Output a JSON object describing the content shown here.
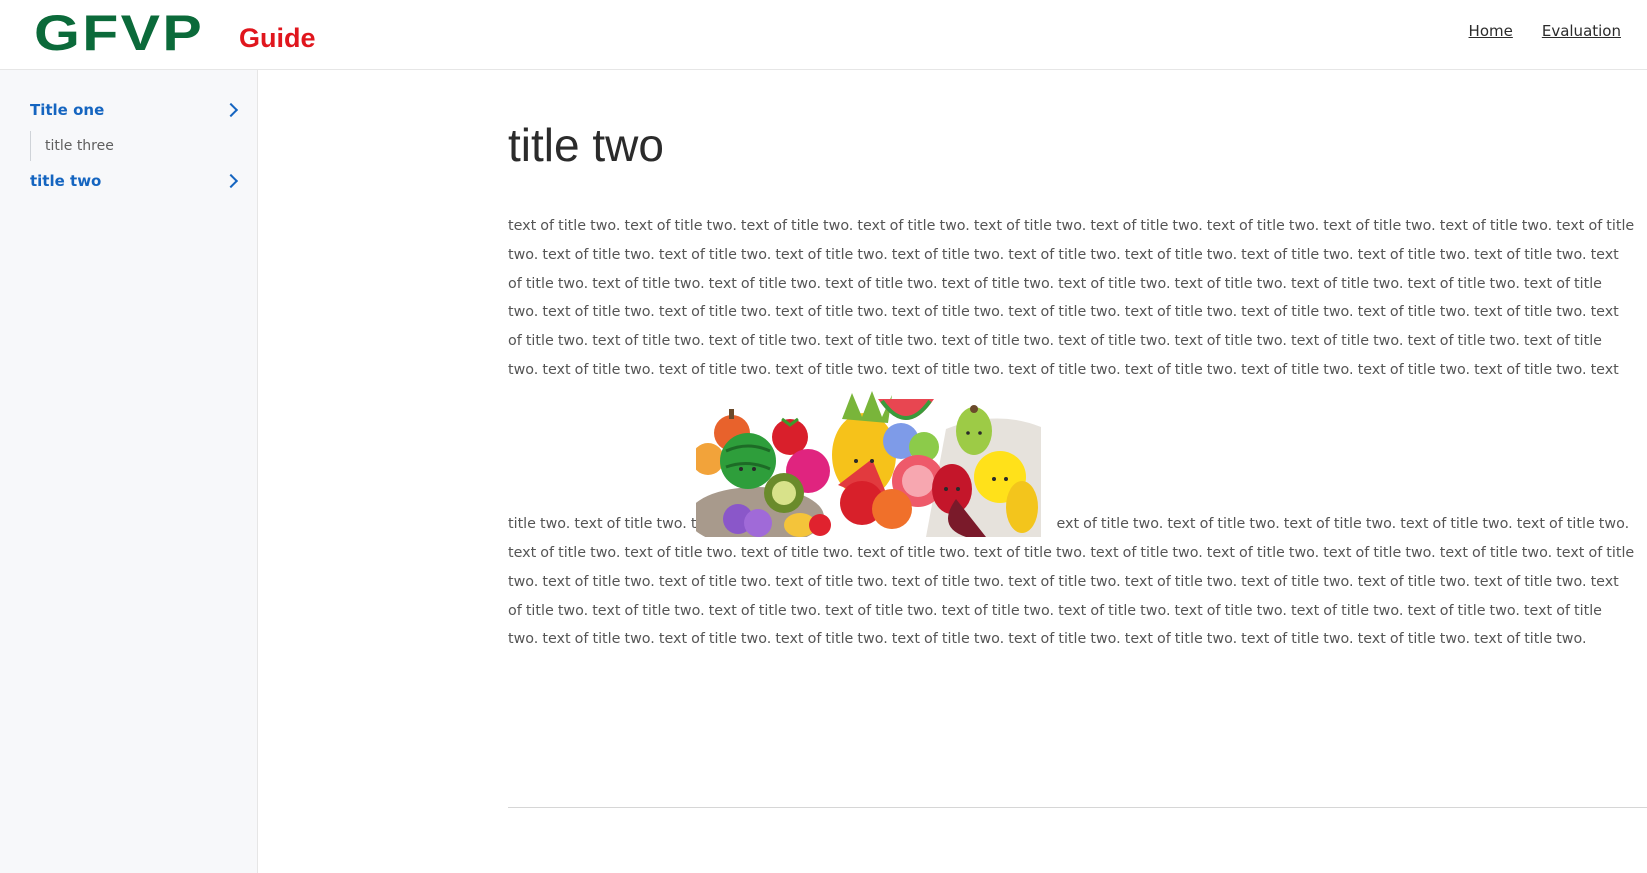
{
  "header": {
    "logo_main": "GFVP",
    "logo_sub": "Guide",
    "nav": [
      "Home",
      "Evaluation"
    ]
  },
  "sidebar": {
    "items": [
      {
        "label": "Title one",
        "children": [
          "title three"
        ]
      },
      {
        "label": "title two"
      }
    ]
  },
  "main": {
    "title": "title two",
    "paragraph_1": "text of title two. text of title two. text of title two. text of title two. text of title two. text of title two. text of title two. text of title two. text of title two. text of title two. text of title two. text of title two. text of title two. text of title two. text of title two. text of title two. text of title two. text of title two. text of title two. text of title two. text of title two. text of title two. text of title two. text of title two. text of title two. text of title two. text of title two. text of title two. text of title two. text of title two. text of title two. text of title two. text of title two. text of title two. text of title two. text of title two. text of title two. text of title two. text of title two. text of title two. text of title two. text of title two. text of title two. text of title two. text of title two. text of title two. text of title two. text of title two. text of title two. text of title two. text of title two. text of title two. text of title two. text of title two. text of title two. text of title two. text of title two. text of title two. text of title two. text of title two.",
    "paragraph_2_before": "title two. text of title two. t",
    "paragraph_2_after": "ext of title two. text of title two. text of title two. text of title two. text of title two. text of title two. text of title two. text of title two. text of title two. text of title two. text of title two. text of title two. text of title two. text of title two. text of title two. text of title two. text of title two. text of title two. text of title two. text of title two. text of title two. text of title two. text of title two. text of title two. text of title two. text of title two. text of title two. text of title two. text of title two. text of title two. text of title two. text of title two. text of title two. text of title two. text of title two. text of title two. text of title two. text of title two. text of title two. text of title two. text of title two. text of title two. text of title two.",
    "image": "crocheted-fruits-photo"
  },
  "colors": {
    "logo_green": "#0b6a3a",
    "logo_red": "#e0161d",
    "link_blue": "#1565c0",
    "sidebar_bg": "#f7f8fa",
    "text_gray": "#555555"
  }
}
